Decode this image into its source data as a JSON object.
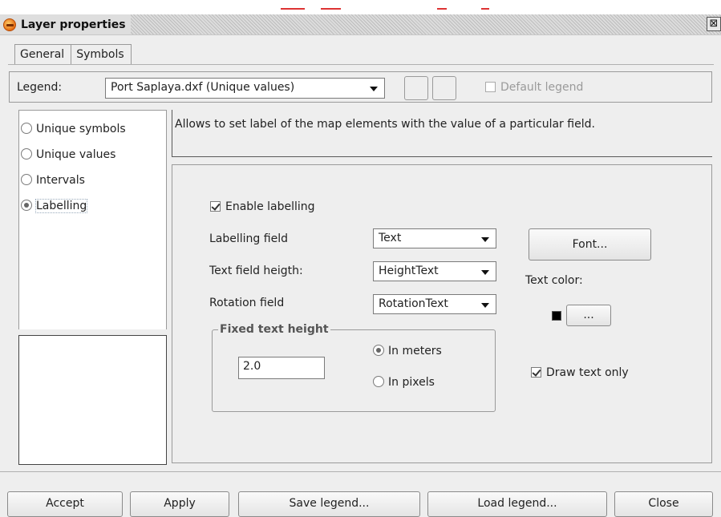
{
  "window": {
    "title": "Layer properties",
    "close_glyph": "⊠"
  },
  "tabs": [
    {
      "label": "General"
    },
    {
      "label": "Symbols"
    }
  ],
  "legend_bar": {
    "label": "Legend:",
    "selected": "Port Saplaya.dxf (Unique values)",
    "default_legend_label": "Default legend",
    "default_legend_checked": false
  },
  "legend_types": [
    {
      "label": "Unique symbols",
      "selected": false
    },
    {
      "label": "Unique values",
      "selected": false
    },
    {
      "label": "Intervals",
      "selected": false
    },
    {
      "label": "Labelling",
      "selected": true
    }
  ],
  "description": "Allows to set label of the map elements with the value of a particular field.",
  "labelling": {
    "enable_label": "Enable labelling",
    "enable_checked": true,
    "field_label": "Labelling field",
    "field_value": "Text",
    "height_label": "Text field heigth:",
    "height_value": "HeightText",
    "rotation_label": "Rotation field",
    "rotation_value": "RotationText",
    "font_button": "Font...",
    "text_color_label": "Text color:",
    "text_color": "#000000",
    "color_button": "...",
    "fixed_height_title": "Fixed text height",
    "fixed_height_value": "2.0",
    "in_meters": "In meters",
    "in_meters_selected": true,
    "in_pixels": "In pixels",
    "in_pixels_selected": false,
    "draw_text_only": "Draw text only",
    "draw_text_only_checked": true
  },
  "buttons": {
    "accept": "Accept",
    "apply": "Apply",
    "save_legend": "Save legend...",
    "load_legend": "Load legend...",
    "close": "Close"
  }
}
